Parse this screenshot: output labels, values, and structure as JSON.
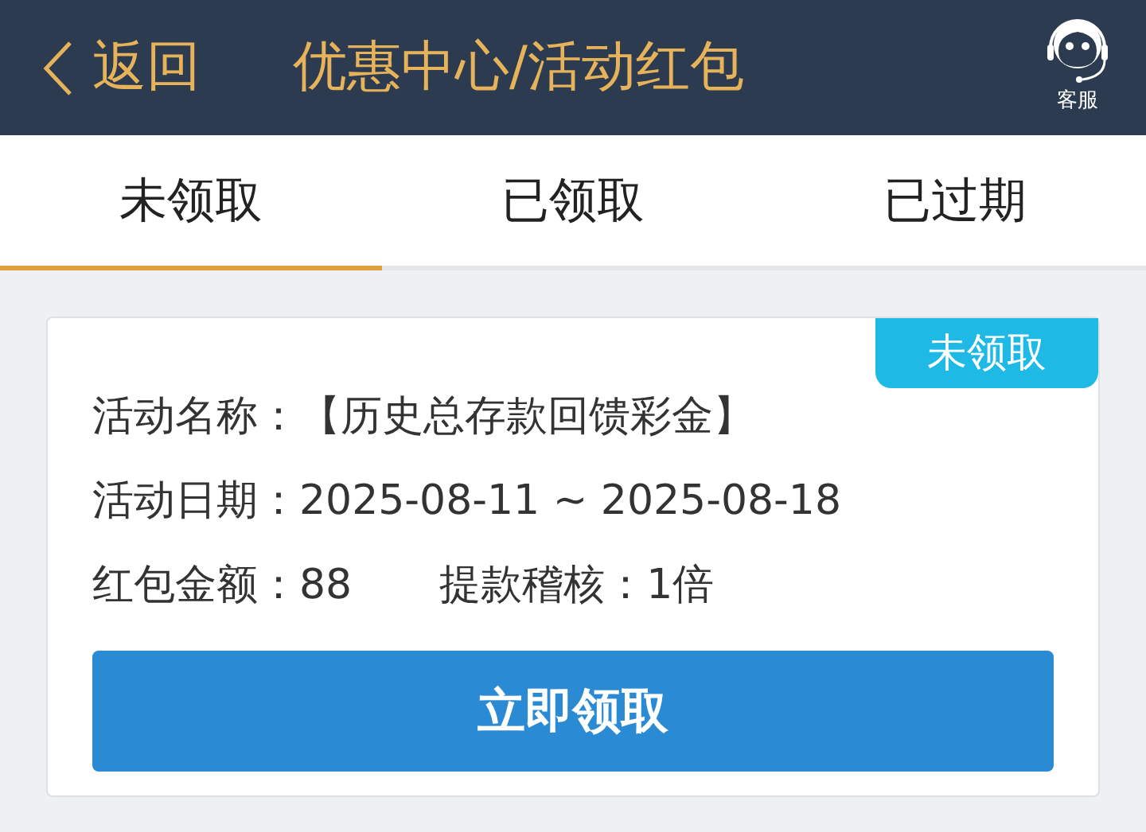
{
  "header": {
    "back_label": "返回",
    "title": "优惠中心/活动红包",
    "service_label": "客服"
  },
  "tabs": [
    {
      "label": "未领取",
      "selected": true
    },
    {
      "label": "已领取",
      "selected": false
    },
    {
      "label": "已过期",
      "selected": false
    }
  ],
  "card": {
    "status_badge": "未领取",
    "rows": [
      [
        {
          "label": "活动名称：",
          "value": "【历史总存款回馈彩金】"
        }
      ],
      [
        {
          "label": "活动日期：",
          "value": "2025-08-11 ~ 2025-08-18"
        }
      ],
      [
        {
          "label": "红包金额：",
          "value": "88"
        },
        {
          "label": "提款稽核：",
          "value": "1倍"
        }
      ]
    ],
    "button": "立即领取"
  }
}
